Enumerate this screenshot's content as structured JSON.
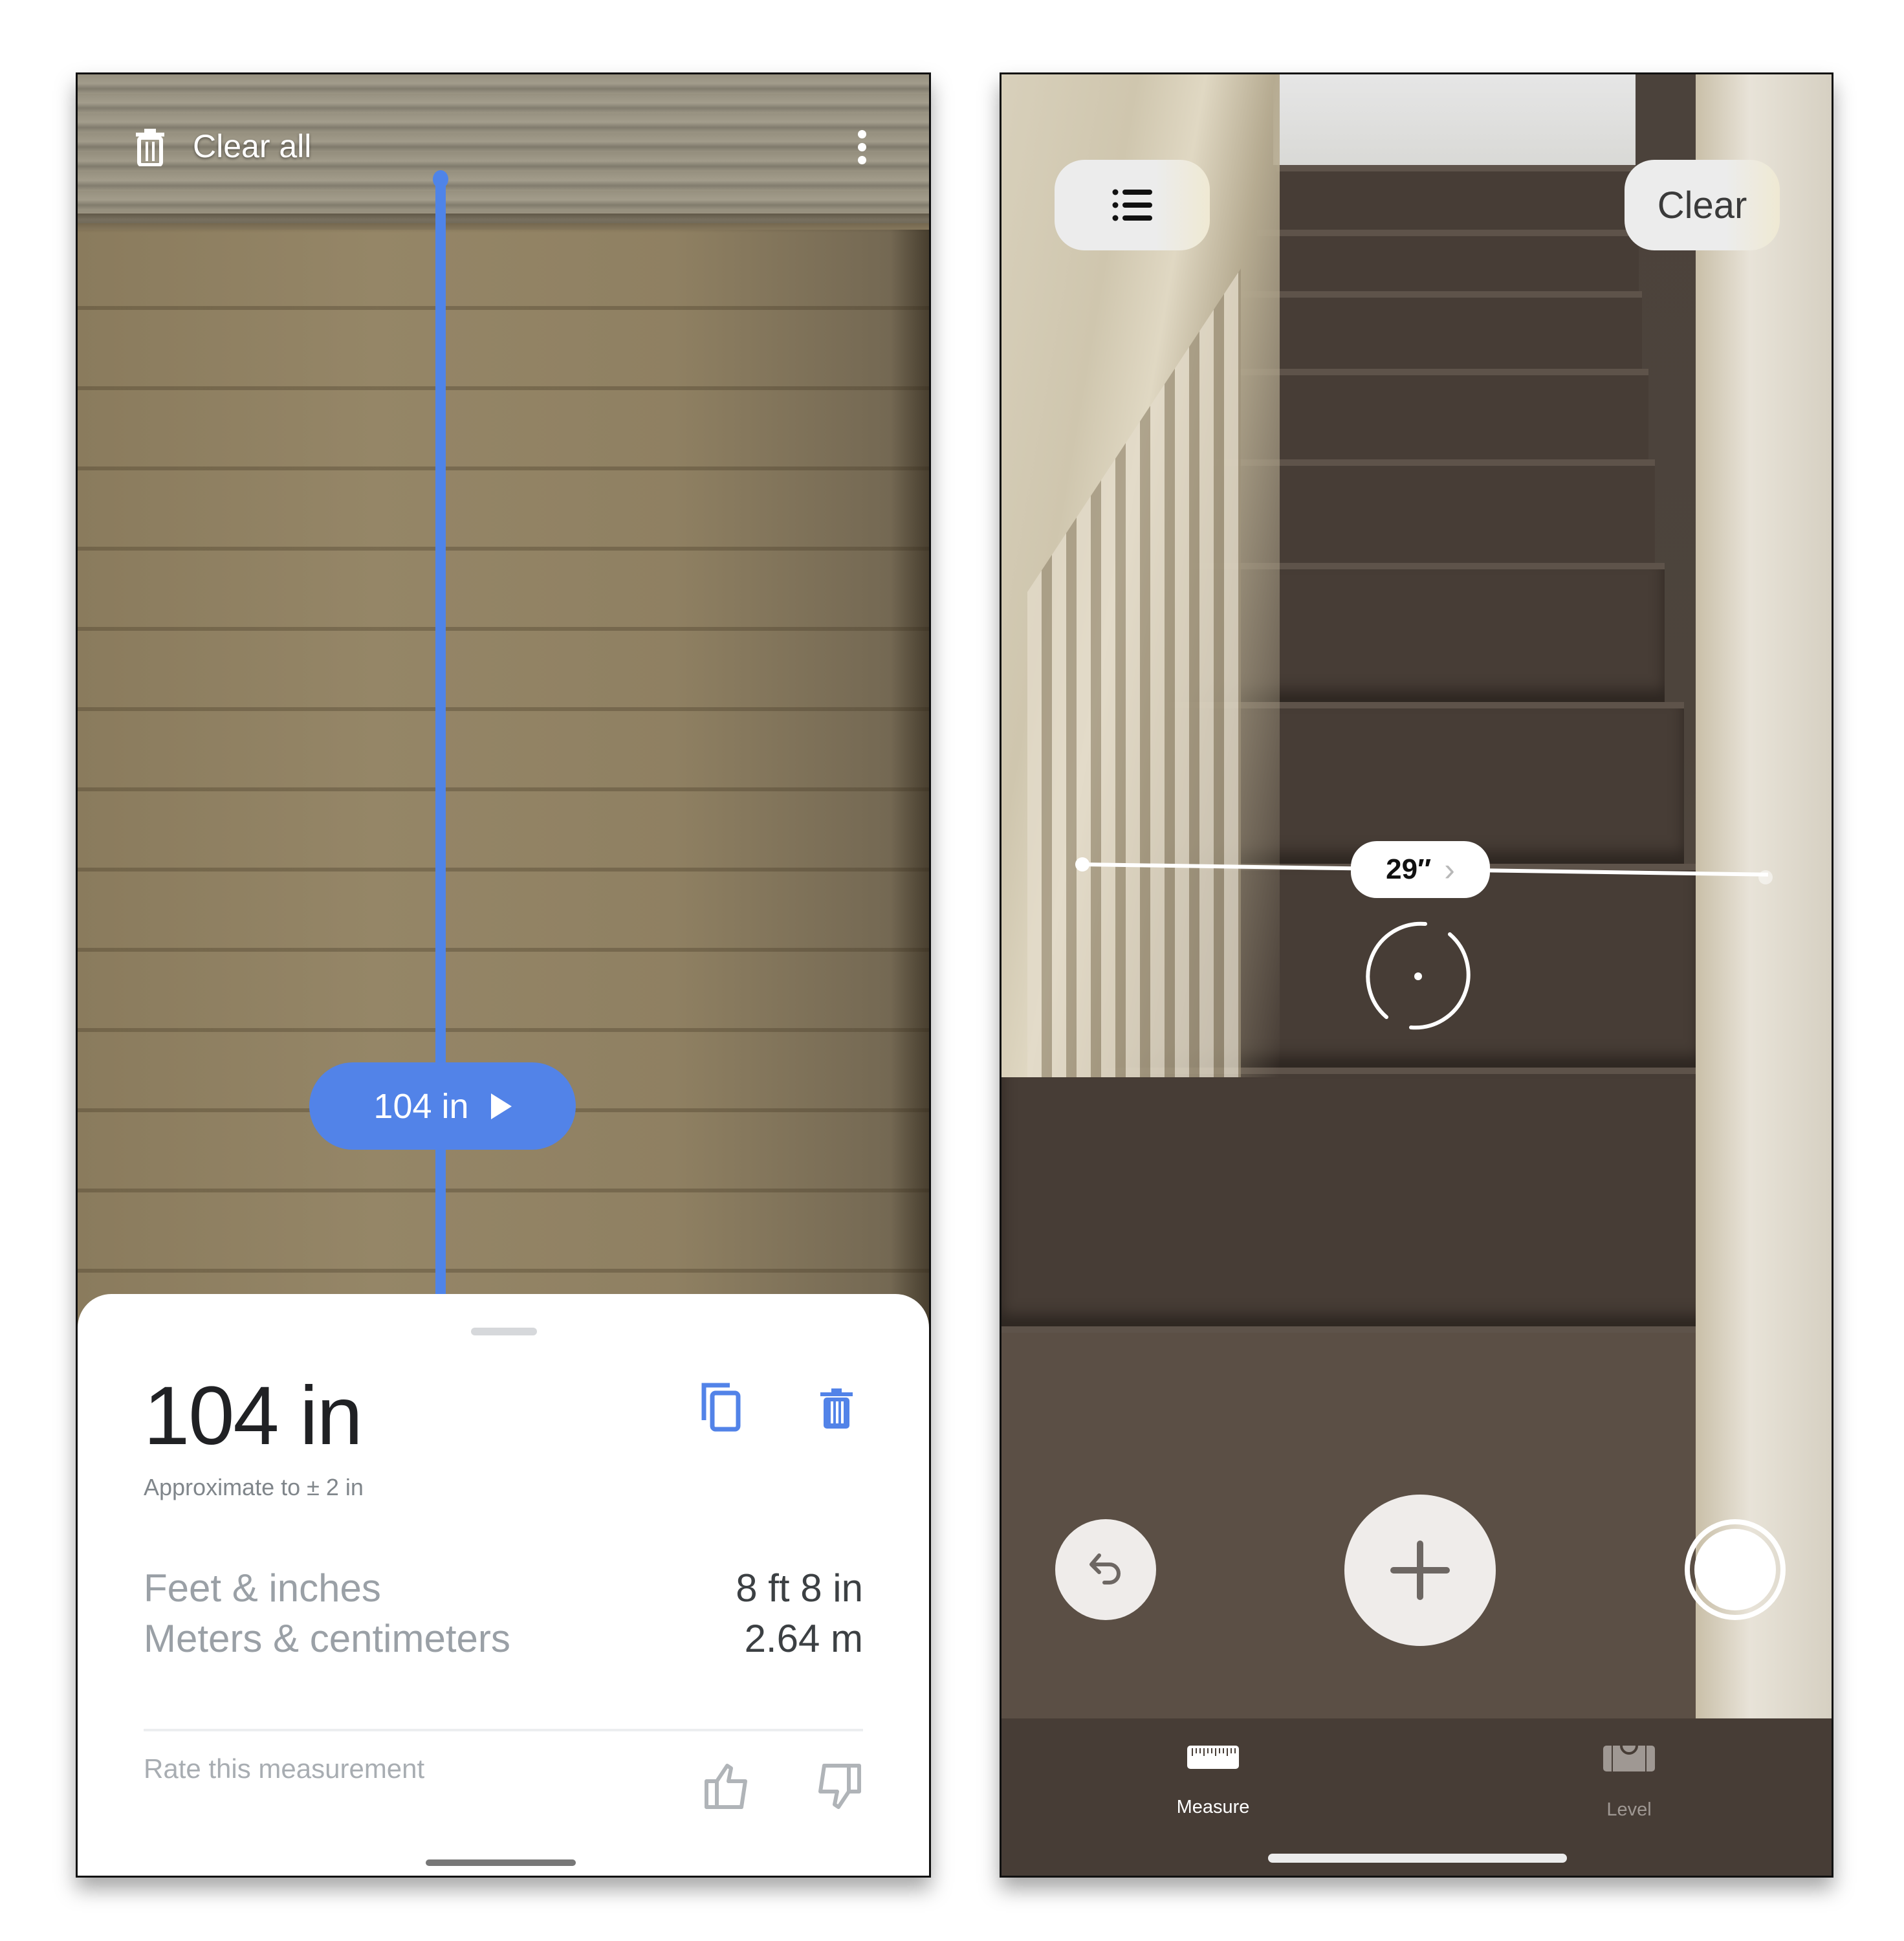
{
  "left_screen": {
    "toolbar": {
      "clear_all_label": "Clear all",
      "trash_icon": "trash-icon",
      "more_icon": "more-vert-icon"
    },
    "measurement_pill": {
      "value": "104 in",
      "icon": "play-icon"
    },
    "accent_color": "#4f84e8",
    "sheet": {
      "measurement": "104 in",
      "accuracy": "Approximate to ± 2 in",
      "copy_icon": "copy-icon",
      "delete_icon": "delete-icon",
      "conversions": [
        {
          "label": "Feet & inches",
          "value": "8 ft 8 in"
        },
        {
          "label": "Meters & centimeters",
          "value": "2.64 m"
        }
      ],
      "rate_label": "Rate this measurement",
      "thumbs_up_icon": "thumbs-up-icon",
      "thumbs_down_icon": "thumbs-down-icon"
    }
  },
  "right_screen": {
    "top_buttons": {
      "list_icon": "list-icon",
      "clear_label": "Clear"
    },
    "ar_measurement": {
      "value": "29″",
      "icon": "chevron-right-icon"
    },
    "controls": {
      "undo_icon": "undo-icon",
      "add_icon": "plus-icon",
      "capture_icon": "shutter-icon"
    },
    "tabs": [
      {
        "label": "Measure",
        "icon": "ruler-icon",
        "active": true
      },
      {
        "label": "Level",
        "icon": "level-icon",
        "active": false
      }
    ]
  }
}
